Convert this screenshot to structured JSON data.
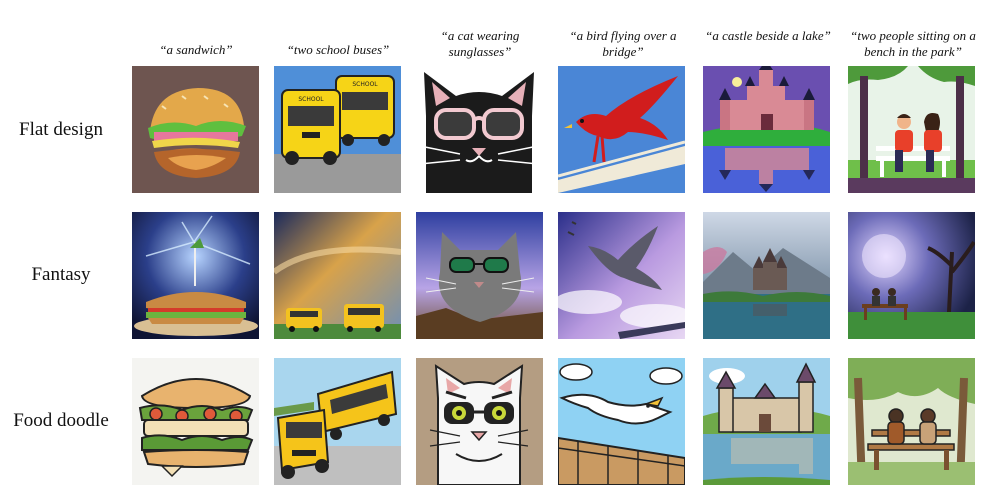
{
  "prompts": [
    "“a sandwich”",
    "“two school buses”",
    "“a cat wearing sunglasses”",
    "“a bird flying over a bridge”",
    "“a castle beside a lake”",
    "“two people sitting on a bench in the park”"
  ],
  "styles": [
    "Flat design",
    "Fantasy",
    "Food doodle"
  ],
  "bus_text": "SCHOOL"
}
